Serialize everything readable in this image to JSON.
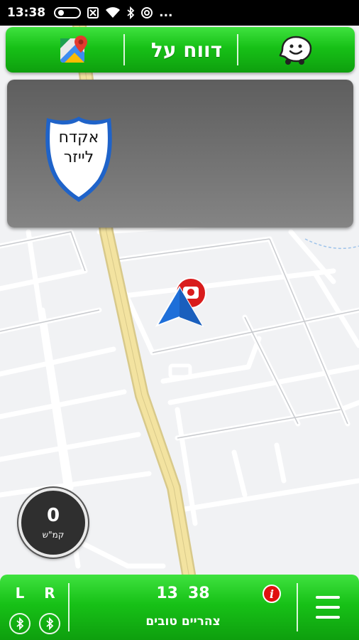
{
  "status_bar": {
    "time": "13:38",
    "icons": [
      "toggle-icon",
      "no-sim-icon",
      "wifi-icon",
      "bluetooth-icon",
      "cast-icon",
      "more-icon"
    ],
    "more": "..."
  },
  "top_bar": {
    "title": "דווח על",
    "left_icon": "google-maps-icon",
    "right_icon": "waze-icon"
  },
  "alert_panel": {
    "sign_line1": "אקדח",
    "sign_line2": "לייזר",
    "sign_border_color": "#1f63c9"
  },
  "map": {
    "user_marker_color": "#1e6fd9",
    "report_marker_color": "#d91c1c"
  },
  "speedometer": {
    "value": "0",
    "unit": "קמ\"ש"
  },
  "bottom_bar": {
    "left_label": "L",
    "right_label": "R",
    "clock_minutes": "38",
    "clock_hours": "13",
    "greeting": "צהריים טובים",
    "info_icon": "i"
  },
  "colors": {
    "bar_green": "#17c117",
    "panel_gray": "#6e6e6e",
    "road_yellow": "#f3e3a0"
  }
}
